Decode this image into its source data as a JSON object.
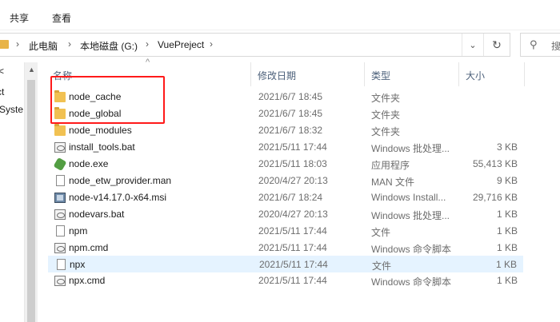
{
  "ribbon": {
    "tabs": [
      {
        "label": "共享"
      },
      {
        "label": "查看"
      }
    ]
  },
  "address": {
    "crumbs": [
      "此电脑",
      "本地磁盘 (G:)",
      "VuePreject"
    ],
    "separator": "›"
  },
  "search": {
    "placeholder": "搜"
  },
  "nav_pane": {
    "items": [
      "ct",
      "Syste"
    ]
  },
  "columns": {
    "name": "名称",
    "date": "修改日期",
    "type": "类型",
    "size": "大小"
  },
  "files": [
    {
      "name": "node_cache",
      "date": "2021/6/7 18:45",
      "type": "文件夹",
      "size": "",
      "icon": "folder-icon"
    },
    {
      "name": "node_global",
      "date": "2021/6/7 18:45",
      "type": "文件夹",
      "size": "",
      "icon": "folder-icon"
    },
    {
      "name": "node_modules",
      "date": "2021/6/7 18:32",
      "type": "文件夹",
      "size": "",
      "icon": "folder-icon"
    },
    {
      "name": "install_tools.bat",
      "date": "2021/5/11 17:44",
      "type": "Windows 批处理...",
      "size": "3 KB",
      "icon": "batch-file-icon"
    },
    {
      "name": "node.exe",
      "date": "2021/5/11 18:03",
      "type": "应用程序",
      "size": "55,413 KB",
      "icon": "node-exe-icon"
    },
    {
      "name": "node_etw_provider.man",
      "date": "2020/4/27 20:13",
      "type": "MAN 文件",
      "size": "9 KB",
      "icon": "file-icon"
    },
    {
      "name": "node-v14.17.0-x64.msi",
      "date": "2021/6/7 18:24",
      "type": "Windows Install...",
      "size": "29,716 KB",
      "icon": "installer-icon"
    },
    {
      "name": "nodevars.bat",
      "date": "2020/4/27 20:13",
      "type": "Windows 批处理...",
      "size": "1 KB",
      "icon": "batch-file-icon"
    },
    {
      "name": "npm",
      "date": "2021/5/11 17:44",
      "type": "文件",
      "size": "1 KB",
      "icon": "file-icon"
    },
    {
      "name": "npm.cmd",
      "date": "2021/5/11 17:44",
      "type": "Windows 命令脚本",
      "size": "1 KB",
      "icon": "batch-file-icon"
    },
    {
      "name": "npx",
      "date": "2021/5/11 17:44",
      "type": "文件",
      "size": "1 KB",
      "icon": "file-icon",
      "selected": true
    },
    {
      "name": "npx.cmd",
      "date": "2021/5/11 17:44",
      "type": "Windows 命令脚本",
      "size": "1 KB",
      "icon": "batch-file-icon"
    }
  ],
  "colors": {
    "selection": "#e5f3ff",
    "annotation": "#ff1a1a",
    "folder": "#f1c152"
  }
}
